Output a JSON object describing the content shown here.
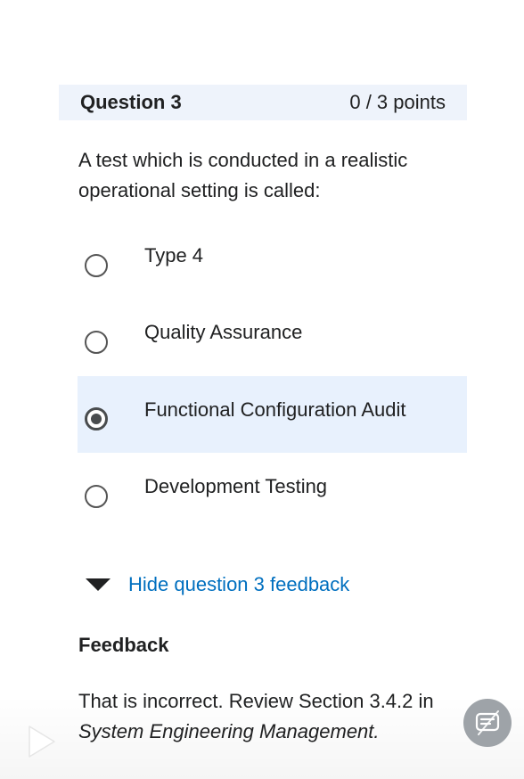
{
  "question": {
    "title": "Question 3",
    "points": "0 / 3 points",
    "text": "A test which is conducted in a realistic operational setting is called:"
  },
  "options": [
    {
      "label": "Type 4",
      "selected": false
    },
    {
      "label": "Quality Assurance",
      "selected": false
    },
    {
      "label": "Functional Configuration Audit",
      "selected": true
    },
    {
      "label": "Development Testing",
      "selected": false
    }
  ],
  "feedback": {
    "toggle_label": "Hide question 3 feedback",
    "heading": "Feedback",
    "text_prefix": "That is incorrect. Review Section 3.4.2 in",
    "text_italic": "System Engineering Management."
  },
  "icons": {
    "play": "play-icon",
    "subtitles": "subtitles-icon",
    "caret": "caret-down-icon"
  },
  "colors": {
    "header_bg": "#eef3fb",
    "selected_bg": "#e8f1fd",
    "link": "#006fbf"
  }
}
